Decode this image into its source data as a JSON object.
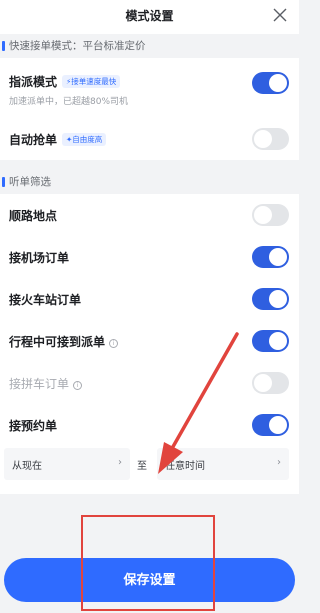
{
  "header": {
    "title": "模式设置",
    "close_icon": "close-icon"
  },
  "fast_section": {
    "label": "快速接单模式：平台标准定价"
  },
  "assign_mode": {
    "label": "指派模式",
    "tag": "⚡接单速度最快",
    "sub": "加速派单中，已超越80%司机",
    "enabled": true
  },
  "auto_grab": {
    "label": "自动抢单",
    "tag": "✦自由度高",
    "enabled": false
  },
  "filter_section": {
    "label": "听单筛选"
  },
  "filters": [
    {
      "label": "顺路地点",
      "enabled": false,
      "info": false,
      "disabled": false
    },
    {
      "label": "接机场订单",
      "enabled": true,
      "info": false,
      "disabled": false
    },
    {
      "label": "接火车站订单",
      "enabled": true,
      "info": false,
      "disabled": false
    },
    {
      "label": "行程中可接到派单",
      "enabled": true,
      "info": true,
      "disabled": false
    },
    {
      "label": "接拼车订单",
      "enabled": false,
      "info": true,
      "disabled": true
    },
    {
      "label": "接预约单",
      "enabled": true,
      "info": false,
      "disabled": false
    }
  ],
  "reservation_time": {
    "from": "从现在",
    "to_label": "至",
    "to": "任意时间"
  },
  "save_button": {
    "label": "保存设置"
  },
  "colors": {
    "accent": "#2f6bff",
    "toggle_on": "#2f5fe0",
    "toggle_off": "#e3e5e8",
    "annotation_red": "#e1443d"
  }
}
